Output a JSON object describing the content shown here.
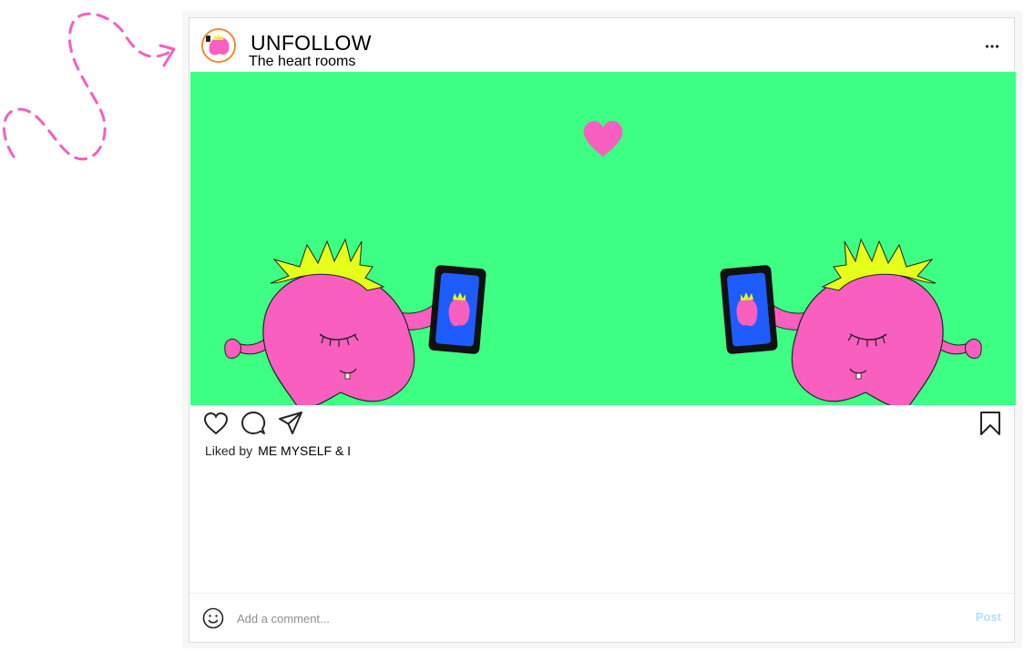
{
  "post": {
    "username": "UNFOLLOW",
    "location": "The heart rooms",
    "liked_by_label": "Liked by",
    "liked_by_user": "ME MYSELF & I",
    "comment_placeholder": "Add a comment...",
    "post_label": "Post"
  },
  "icons": {
    "more": "more-options-icon",
    "like": "heart-icon",
    "comment": "comment-icon",
    "share": "paper-plane-icon",
    "save": "bookmark-icon",
    "emoji": "smiley-icon"
  },
  "colors": {
    "image_background": "#3dff83",
    "monster_pink": "#f95fbf",
    "hair_yellow": "#e6ff1a",
    "phone_screen": "#1f5cff",
    "doodle_pink": "#f55fc0",
    "post_button": "#b2dffc"
  }
}
